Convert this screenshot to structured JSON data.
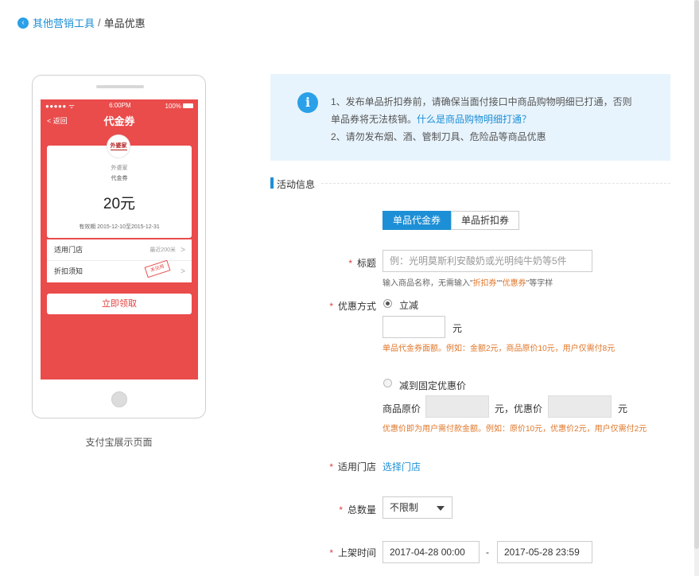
{
  "breadcrumb": {
    "back_icon": "chevron-left-icon",
    "parent": "其他营销工具",
    "separator": "/",
    "current": "单品优惠"
  },
  "preview": {
    "status_left": "●●●●● ᯤ",
    "status_time": "6:00PM",
    "status_battery": "100%",
    "nav_back": "< 返回",
    "nav_title": "代金券",
    "logo_text": "外婆家",
    "shop_name": "外婆家",
    "coupon_type": "代金券",
    "amount": "20元",
    "validity": "有效期 2015-12-10至2015-12-31",
    "rows": [
      {
        "label": "适用门店",
        "right": "最近200米",
        "chevron": ">"
      },
      {
        "label": "折扣须知",
        "right": "",
        "chevron": ">",
        "stamp": "未兑用"
      }
    ],
    "claim_button": "立即领取",
    "caption": "支付宝展示页面"
  },
  "notice": {
    "icon": "info-icon",
    "line1": "1、发布单品折扣券前，请确保当面付接口中商品购物明细已打通，否则",
    "line2_prefix": "单品券将无法核销。",
    "line2_link": "什么是商品购物明细打通？",
    "line3": "2、请勿发布烟、酒、管制刀具、危险品等商品优惠"
  },
  "section": {
    "title": "活动信息"
  },
  "tabs": [
    {
      "label": "单品代金券",
      "active": true
    },
    {
      "label": "单品折扣券",
      "active": false
    }
  ],
  "form": {
    "required_mark": "*",
    "title_label": "标题",
    "title_placeholder": "例：光明莫斯利安酸奶或光明纯牛奶等5件",
    "title_hint_prefix": "输入商品名称，无需输入\"",
    "title_hint_word1": "折扣券",
    "title_hint_mid": "\"\"",
    "title_hint_word2": "优惠券",
    "title_hint_suffix": "\"等字样",
    "discount_label": "优惠方式",
    "option1_label": "立减",
    "option1_value": "",
    "unit_yuan": "元",
    "option1_hint": "单品代金券面额。例如：金额2元，商品原价10元，用户仅需付8元",
    "option2_label": "减到固定优惠价",
    "orig_price_label": "商品原价",
    "orig_price_value": "",
    "mid_text": "元，优惠价",
    "promo_price_value": "",
    "option2_hint": "优惠价即为用户需付款金额。例如：原价10元，优惠价2元，用户仅需付2元",
    "store_label": "适用门店",
    "store_link": "选择门店",
    "quantity_label": "总数量",
    "quantity_value": "不限制",
    "time_label": "上架时间",
    "time_start": "2017-04-28 00:00",
    "time_sep": "-",
    "time_end": "2017-05-28 23:59"
  },
  "colors": {
    "accent": "#1d8fd6",
    "preview_red": "#ea4b4b",
    "notice_bg": "#e8f4fd",
    "required": "#e04040",
    "hint_orange": "#e0772a"
  }
}
